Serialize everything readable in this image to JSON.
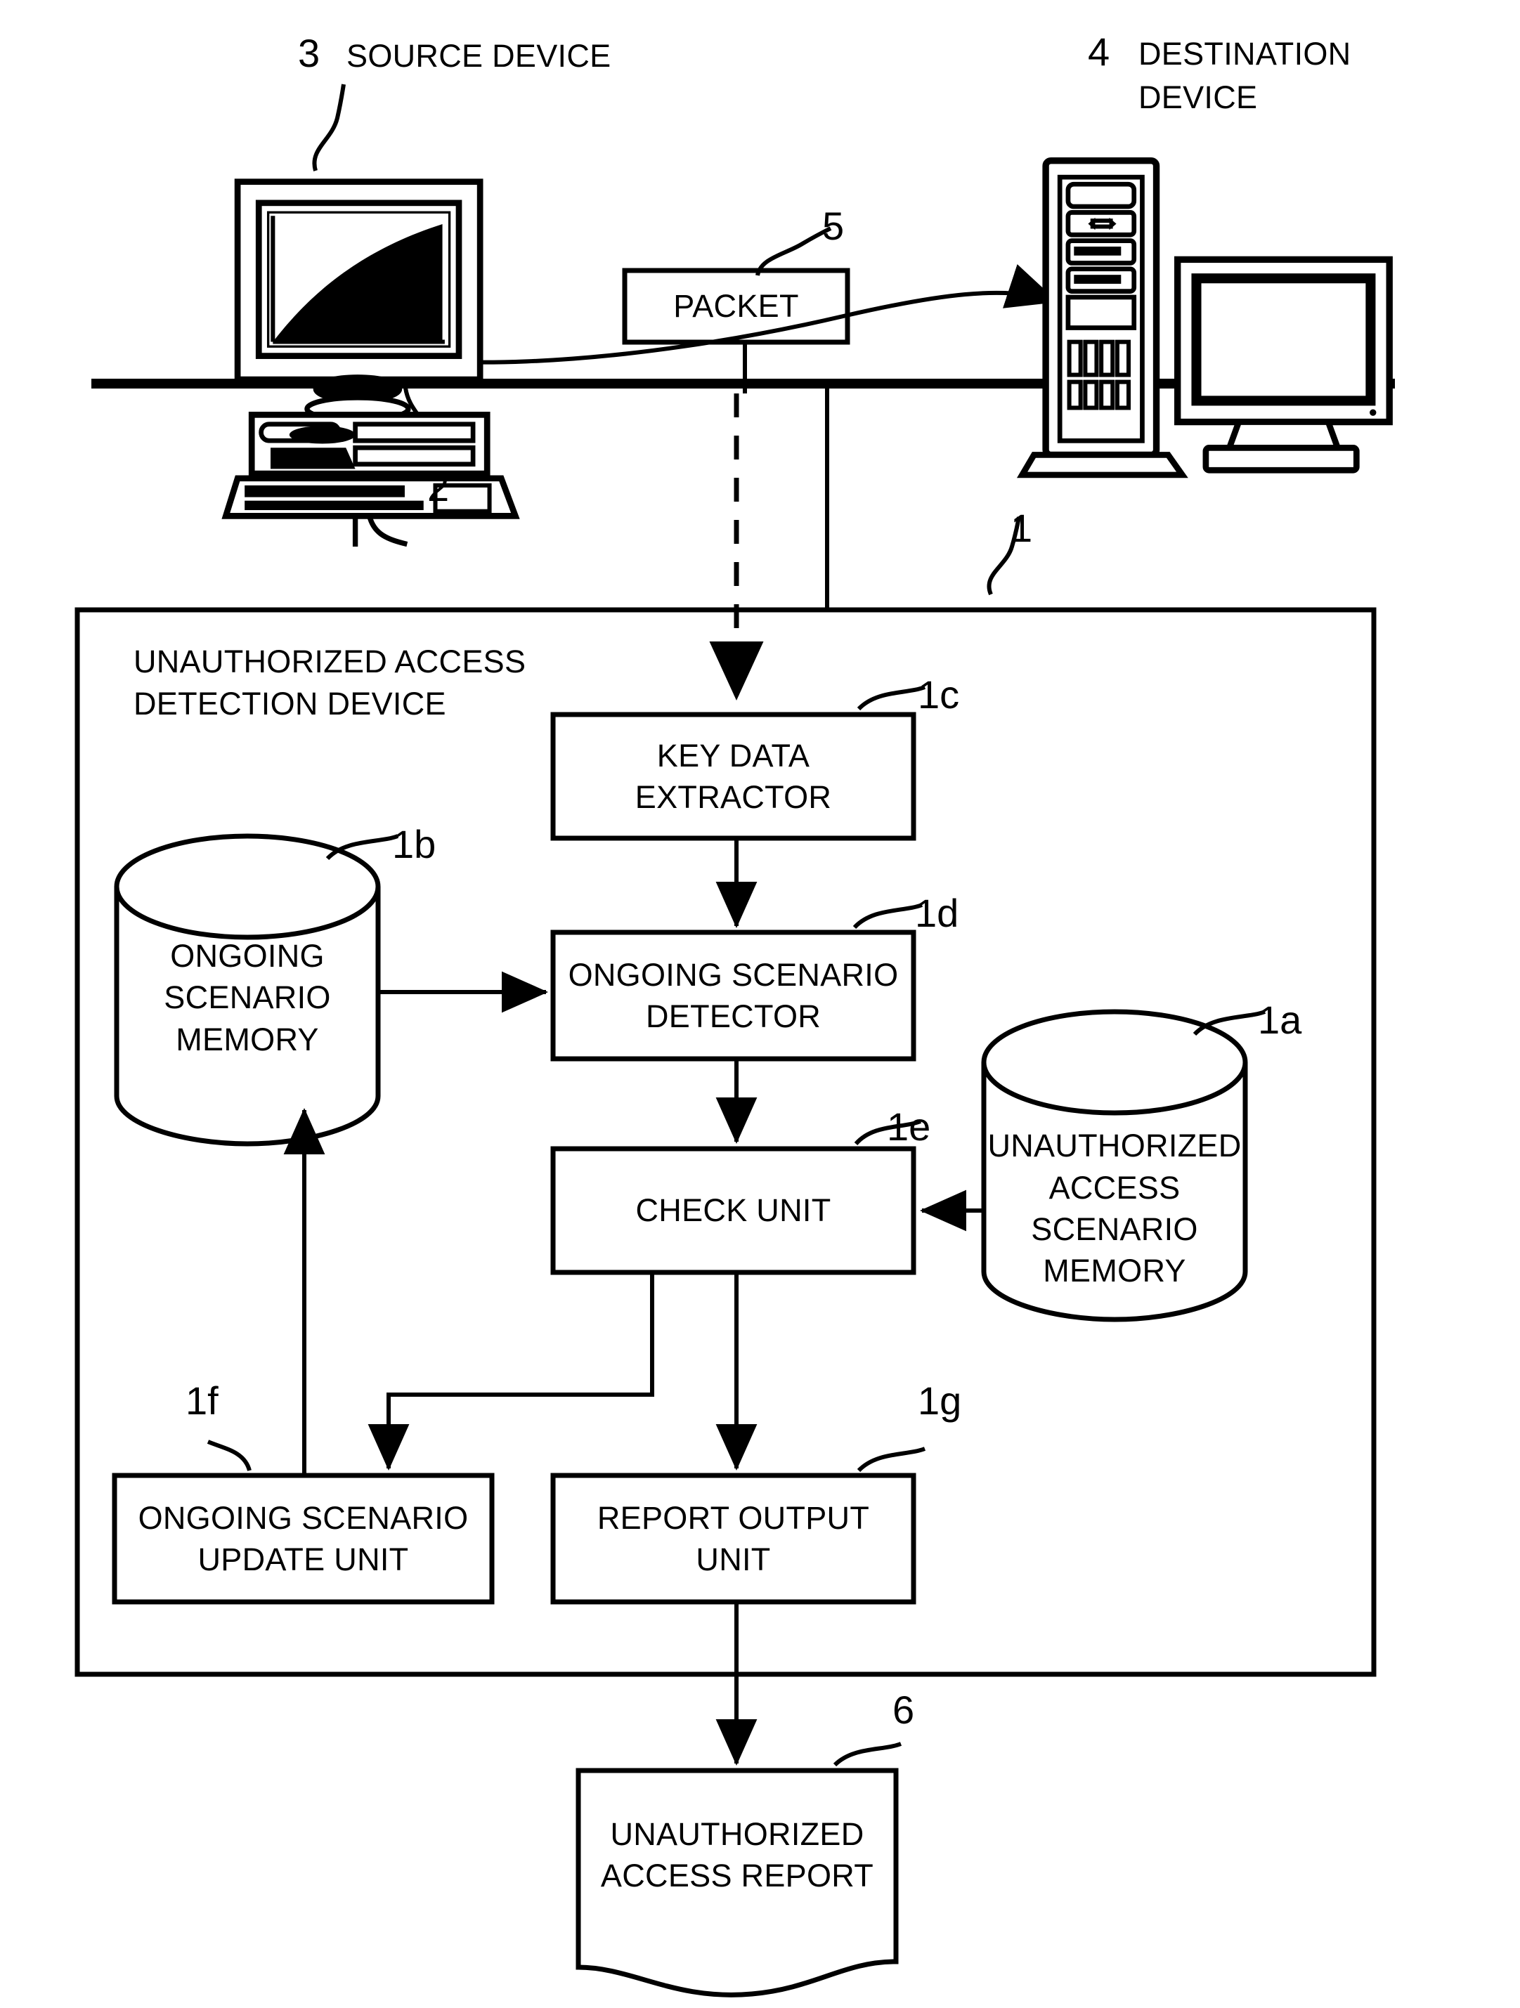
{
  "figure": {
    "type": "patent-block-diagram",
    "title": "Unauthorized access detection device block diagram"
  },
  "reference_numerals": {
    "device": "1",
    "unauthorized_access_scenario_memory": "1a",
    "ongoing_scenario_memory": "1b",
    "key_data_extractor": "1c",
    "ongoing_scenario_detector": "1d",
    "check_unit": "1e",
    "ongoing_scenario_update_unit": "1f",
    "report_output_unit": "1g",
    "network": "2",
    "source_device": "3",
    "destination_device": "4",
    "packet": "5",
    "report": "6"
  },
  "top": {
    "source_label": "SOURCE DEVICE",
    "destination_label_line1": "DESTINATION",
    "destination_label_line2": "DEVICE",
    "packet_label": "PACKET"
  },
  "container": {
    "title_line1": "UNAUTHORIZED ACCESS",
    "title_line2": "DETECTION DEVICE"
  },
  "blocks": [
    {
      "id": "key-data-extractor",
      "ref": "1c",
      "shape": "rect",
      "lines": [
        "KEY DATA",
        "EXTRACTOR"
      ]
    },
    {
      "id": "ongoing-scenario-memory",
      "ref": "1b",
      "shape": "cylinder",
      "lines": [
        "ONGOING SCENARIO",
        "MEMORY"
      ]
    },
    {
      "id": "ongoing-scenario-detector",
      "ref": "1d",
      "shape": "rect",
      "lines": [
        "ONGOING SCENARIO",
        "DETECTOR"
      ]
    },
    {
      "id": "check-unit",
      "ref": "1e",
      "shape": "rect",
      "lines": [
        "CHECK UNIT"
      ]
    },
    {
      "id": "unauthorized-access-scenario-memory",
      "ref": "1a",
      "shape": "cylinder",
      "lines": [
        "UNAUTHORIZED",
        "ACCESS SCENARIO",
        "MEMORY"
      ]
    },
    {
      "id": "ongoing-scenario-update-unit",
      "ref": "1f",
      "shape": "rect",
      "lines": [
        "ONGOING SCENARIO",
        "UPDATE UNIT"
      ]
    },
    {
      "id": "report-output-unit",
      "ref": "1g",
      "shape": "rect",
      "lines": [
        "REPORT OUTPUT",
        "UNIT"
      ]
    },
    {
      "id": "unauthorized-access-report",
      "ref": "6",
      "shape": "document",
      "lines": [
        "UNAUTHORIZED",
        "ACCESS REPORT"
      ]
    }
  ],
  "block_text": {
    "key_data_extractor_l1": "KEY DATA",
    "key_data_extractor_l2": "EXTRACTOR",
    "ongoing_scenario_memory_l1": "ONGOING SCENARIO",
    "ongoing_scenario_memory_l2": "MEMORY",
    "ongoing_scenario_detector_l1": "ONGOING SCENARIO",
    "ongoing_scenario_detector_l2": "DETECTOR",
    "check_unit_l1": "CHECK UNIT",
    "uas_memory_l1": "UNAUTHORIZED",
    "uas_memory_l2": "ACCESS SCENARIO",
    "uas_memory_l3": "MEMORY",
    "update_unit_l1": "ONGOING SCENARIO",
    "update_unit_l2": "UPDATE UNIT",
    "report_output_l1": "REPORT OUTPUT",
    "report_output_l2": "UNIT",
    "report_doc_l1": "UNAUTHORIZED",
    "report_doc_l2": "ACCESS REPORT"
  },
  "colors": {
    "ink": "#000000",
    "paper": "#ffffff"
  },
  "icons": {
    "source": "desktop-computer-icon",
    "destination": "tower-computer-icon"
  }
}
